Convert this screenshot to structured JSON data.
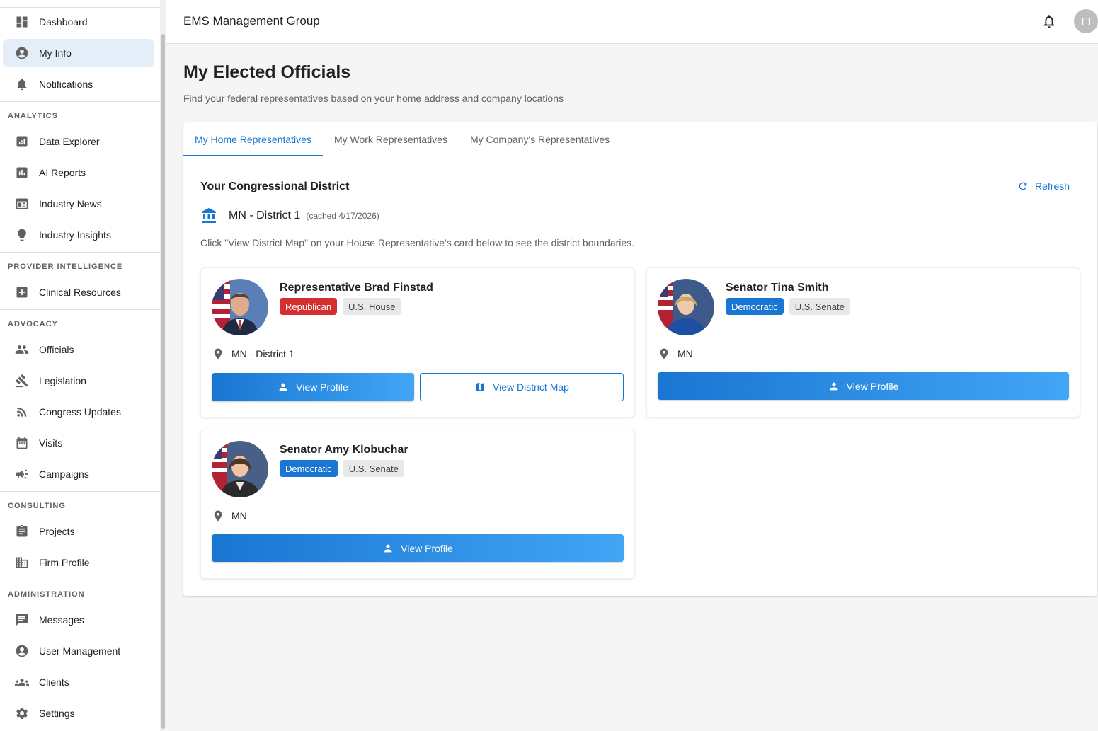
{
  "sidebar": {
    "items": [
      {
        "label": "Dashboard",
        "icon": "dashboard-icon"
      },
      {
        "label": "My Info",
        "icon": "account-circle-icon",
        "active": true
      },
      {
        "label": "Notifications",
        "icon": "bell-icon"
      },
      {
        "label": "Data Explorer",
        "icon": "bar-chart-icon"
      },
      {
        "label": "AI Reports",
        "icon": "chart-box-icon"
      },
      {
        "label": "Industry News",
        "icon": "newspaper-icon"
      },
      {
        "label": "Industry Insights",
        "icon": "lightbulb-icon"
      },
      {
        "label": "Clinical Resources",
        "icon": "medical-plus-icon"
      },
      {
        "label": "Officials",
        "icon": "people-icon"
      },
      {
        "label": "Legislation",
        "icon": "gavel-icon"
      },
      {
        "label": "Congress Updates",
        "icon": "rss-icon"
      },
      {
        "label": "Visits",
        "icon": "calendar-icon"
      },
      {
        "label": "Campaigns",
        "icon": "megaphone-icon"
      },
      {
        "label": "Projects",
        "icon": "clipboard-icon"
      },
      {
        "label": "Firm Profile",
        "icon": "building-icon"
      },
      {
        "label": "Messages",
        "icon": "message-icon"
      },
      {
        "label": "User Management",
        "icon": "account-circle-icon"
      },
      {
        "label": "Clients",
        "icon": "groups-icon"
      },
      {
        "label": "Settings",
        "icon": "gear-icon"
      }
    ],
    "sections": {
      "analytics": "ANALYTICS",
      "provider": "PROVIDER INTELLIGENCE",
      "advocacy": "ADVOCACY",
      "consulting": "CONSULTING",
      "administration": "ADMINISTRATION"
    }
  },
  "header": {
    "org_name": "EMS Management Group",
    "avatar_initials": "TT"
  },
  "main": {
    "title": "My Elected Officials",
    "subtitle": "Find your federal representatives based on your home address and company locations",
    "tabs": [
      {
        "label": "My Home Representatives",
        "active": true
      },
      {
        "label": "My Work Representatives"
      },
      {
        "label": "My Company's Representatives"
      }
    ],
    "district": {
      "heading": "Your Congressional District",
      "refresh_label": "Refresh",
      "name": "MN - District 1",
      "cached": "(cached 4/17/2026)",
      "hint": "Click \"View District Map\" on your House Representative's card below to see the district boundaries."
    },
    "officials": [
      {
        "name": "Representative Brad Finstad",
        "party": "Republican",
        "chamber": "U.S. House",
        "location": "MN - District 1",
        "profile_label": "View Profile",
        "map_label": "View District Map"
      },
      {
        "name": "Senator Tina Smith",
        "party": "Democratic",
        "chamber": "U.S. Senate",
        "location": "MN",
        "profile_label": "View Profile"
      },
      {
        "name": "Senator Amy Klobuchar",
        "party": "Democratic",
        "chamber": "U.S. Senate",
        "location": "MN",
        "profile_label": "View Profile"
      }
    ]
  },
  "colors": {
    "primary": "#1976d2",
    "republican": "#d32f2f",
    "democratic": "#1976d2",
    "active_nav_bg": "#e3eef9"
  }
}
